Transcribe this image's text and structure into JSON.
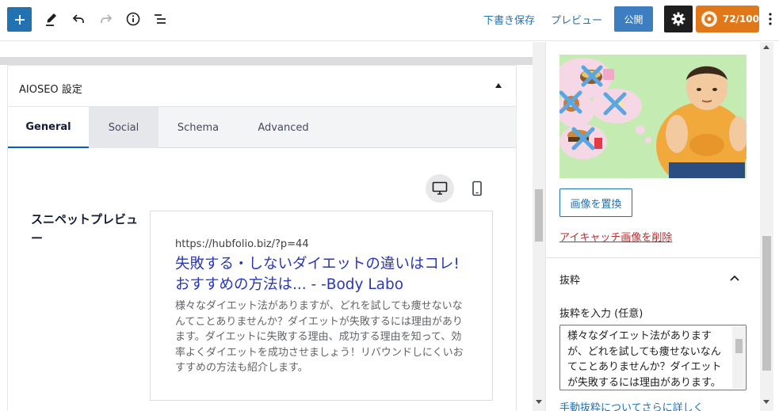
{
  "toolbar": {
    "add_block_icon": "plus-icon",
    "tools_icon": "pen-icon",
    "undo_icon": "undo-icon",
    "redo_icon": "redo-icon",
    "details_icon": "info-icon",
    "list_view_icon": "list-view-icon",
    "save_draft_label": "下書き保存",
    "preview_label": "プレビュー",
    "publish_label": "公開",
    "settings_icon": "gear-icon",
    "seo_score_label": "72/100",
    "more_icon": "vertical-ellipsis-icon"
  },
  "aioseo": {
    "panel_title": "AIOSEO 設定",
    "tabs": [
      {
        "label": "General",
        "active": true
      },
      {
        "label": "Social",
        "active": false
      },
      {
        "label": "Schema",
        "active": false
      },
      {
        "label": "Advanced",
        "active": false
      }
    ],
    "devices": [
      {
        "icon": "desktop-icon",
        "active": true
      },
      {
        "icon": "mobile-icon",
        "active": false
      }
    ],
    "snippet_label": "スニペットプレビュー",
    "snippet": {
      "url": "https://hubfolio.biz/?p=44",
      "title": "失敗する・しないダイエットの違いはコレ! おすすめの方法は... - -Body Labo",
      "description": "様々なダイエット法がありますが、どれを試しても痩せないなんてことありませんか？ダイエットが失敗するには理由があります。ダイエットに失敗する理由、成功する理由を知って、効率よくダイエットを成功させましょう！リバウンドしにくいおすすめの方法も紹介します。"
    }
  },
  "sidebar": {
    "replace_image_label": "画像を置換",
    "remove_image_label": "アイキャッチ画像を削除",
    "excerpt_title": "抜粋",
    "excerpt_label": "抜粋を入力 (任意)",
    "excerpt_text": "様々なダイエット法がありますが、どれを試しても痩せないなんてことありませんか？ダイエットが失敗するには理由があります。",
    "excerpt_link": "手動抜粋についてさらに詳しく"
  },
  "colors": {
    "primary": "#2271b1",
    "publish": "#3c7ec0",
    "score_badge": "#e0781a",
    "link_title": "#2a37b9",
    "remove_link": "#b32d2e"
  }
}
